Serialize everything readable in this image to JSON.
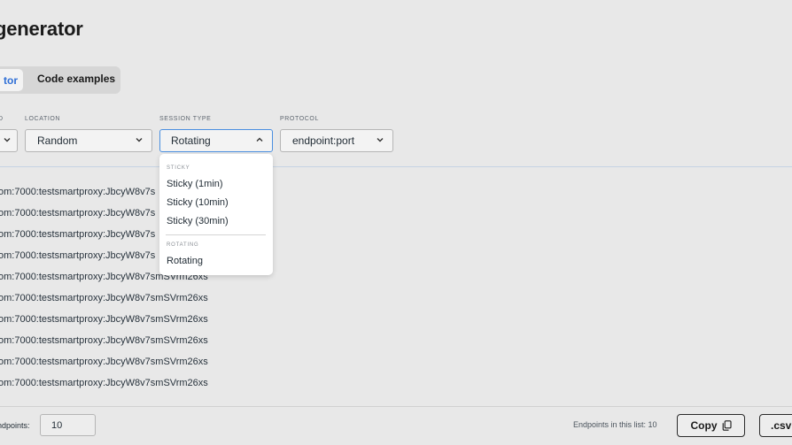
{
  "page": {
    "title": "generator"
  },
  "tabs": [
    {
      "label": "tor",
      "active": true,
      "accent": "#2f6fd6"
    },
    {
      "label": "Code examples",
      "active": false
    }
  ],
  "fields": {
    "partial": {
      "label": "D"
    },
    "location": {
      "label": "LOCATION",
      "value": "Random"
    },
    "session_type": {
      "label": "SESSION TYPE",
      "value": "Rotating",
      "open": true
    },
    "protocol": {
      "label": "PROTOCOL",
      "value": "endpoint:port"
    }
  },
  "dropdown": {
    "sections": [
      {
        "heading": "STICKY",
        "options": [
          "Sticky (1min)",
          "Sticky (10min)",
          "Sticky (30min)"
        ]
      },
      {
        "heading": "ROTATING",
        "options": [
          "Rotating"
        ]
      }
    ]
  },
  "endpoints": [
    "om:7000:testsmartproxy:JbcyW8v7s",
    "om:7000:testsmartproxy:JbcyW8v7s",
    "om:7000:testsmartproxy:JbcyW8v7s",
    "om:7000:testsmartproxy:JbcyW8v7s",
    "om:7000:testsmartproxy:JbcyW8v7smSVrm26xs",
    "om:7000:testsmartproxy:JbcyW8v7smSVrm26xs",
    "om:7000:testsmartproxy:JbcyW8v7smSVrm26xs",
    "om:7000:testsmartproxy:JbcyW8v7smSVrm26xs",
    "om:7000:testsmartproxy:JbcyW8v7smSVrm26xs",
    "om:7000:testsmartproxy:JbcyW8v7smSVrm26xs"
  ],
  "footer": {
    "count_label": "ndpoints:",
    "count_value": "10",
    "endpoints_in_list": "Endpoints in this list: 10",
    "copy_label": "Copy",
    "csv_label": ".csv",
    "copy_icon": "copy-icon"
  }
}
